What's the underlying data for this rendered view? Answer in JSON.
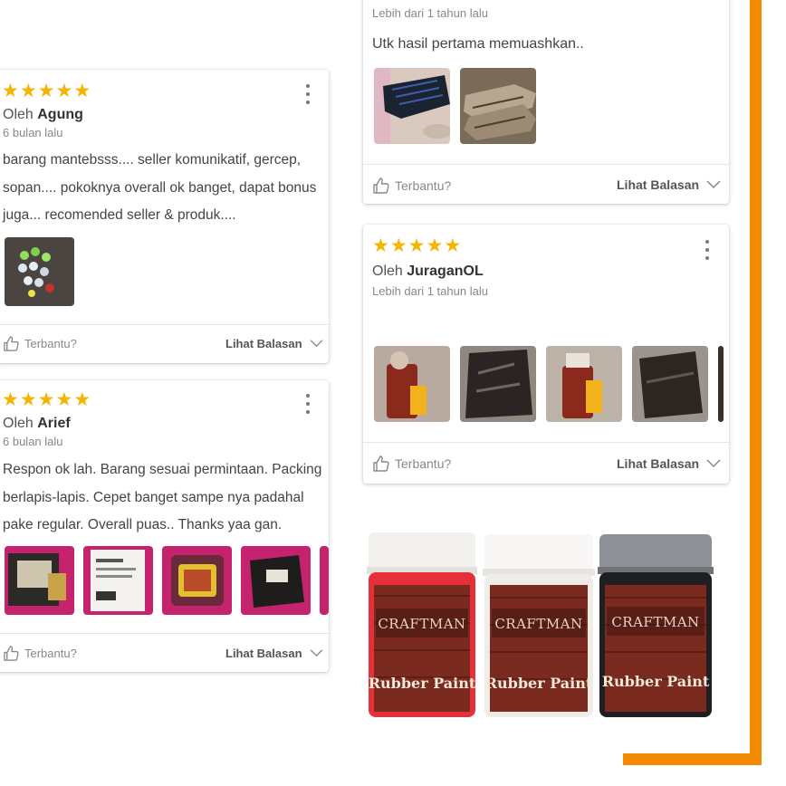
{
  "colors": {
    "accent": "#f28b00",
    "star": "#f5b400"
  },
  "reviews": [
    {
      "rating": 5,
      "by_prefix": "Oleh",
      "author": "Agung",
      "time": "6 bulan lalu",
      "text_lines": [
        "barang mantebsss.... seller komunikatif, gercep,",
        "sopan.... pokoknya overall ok banget, dapat bonus",
        "juga... recomended seller & produk...."
      ],
      "helpful_label": "Terbantu?",
      "reply_label": "Lihat Balasan"
    },
    {
      "rating": 5,
      "by_prefix": "Oleh",
      "author": "Arief",
      "time": "6 bulan lalu",
      "text_lines": [
        "Respon ok lah. Barang sesuai permintaan. Packing",
        "berlapis-lapis. Cepet banget sampe nya padahal",
        "pake regular. Overall puas.. Thanks yaa gan."
      ],
      "helpful_label": "Terbantu?",
      "reply_label": "Lihat Balasan"
    },
    {
      "time": "Lebih dari 1 tahun lalu",
      "text": "Utk hasil pertama memuashkan..",
      "helpful_label": "Terbantu?",
      "reply_label": "Lihat Balasan"
    },
    {
      "rating": 5,
      "by_prefix": "Oleh",
      "author": "JuraganOL",
      "time": "Lebih dari 1 tahun lalu",
      "helpful_label": "Terbantu?",
      "reply_label": "Lihat Balasan"
    }
  ],
  "product_jars": [
    {
      "brand": "CRAFTMAN",
      "name": "Rubber Paint",
      "color": "red"
    },
    {
      "brand": "CRAFTMAN",
      "name": "Rubber Paint",
      "color": "white"
    },
    {
      "brand": "CRAFTMAN",
      "name": "Rubber Paint",
      "color": "black"
    }
  ]
}
